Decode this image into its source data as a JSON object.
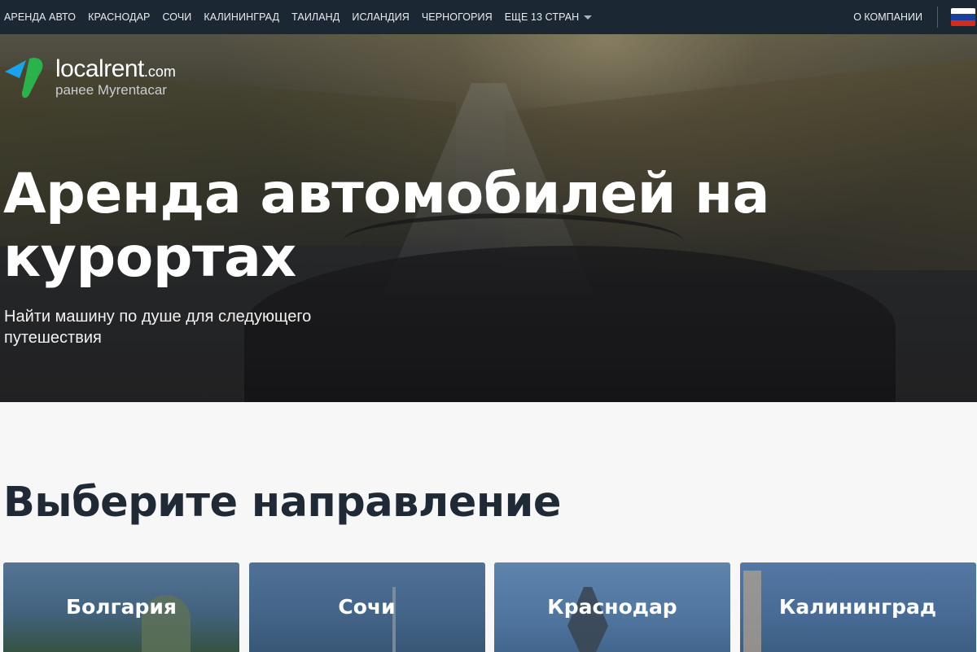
{
  "nav": {
    "links": [
      "АРЕНДА АВТО",
      "КРАСНОДАР",
      "СОЧИ",
      "КАЛИНИНГРАД",
      "ТАИЛАНД",
      "ИСЛАНДИЯ",
      "ЧЕРНОГОРИЯ"
    ],
    "more": "ЕЩЕ 13 СТРАН",
    "more_icon": "chevron-down-icon",
    "about": "О КОМПАНИИ",
    "language_flag": "russia-flag-icon",
    "flag_colors": [
      "#ffffff",
      "#1c3f9e",
      "#d52b1e"
    ],
    "background": "#1b2733"
  },
  "logo": {
    "brand": "localrent",
    "brand_suffix": ".com",
    "formerly": "ранее Myrentacar",
    "icon": "localrent-logo-icon",
    "icon_colors": [
      "#1aa3e8",
      "#2bb24c"
    ]
  },
  "hero": {
    "title": "Аренда автомобилей на курортах",
    "subtitle": "Найти машину по душе для следующего путешествия"
  },
  "destinations": {
    "title": "Выберите направление",
    "cards": [
      {
        "label": "Болгария"
      },
      {
        "label": "Сочи"
      },
      {
        "label": "Краснодар"
      },
      {
        "label": "Калининград"
      }
    ]
  }
}
